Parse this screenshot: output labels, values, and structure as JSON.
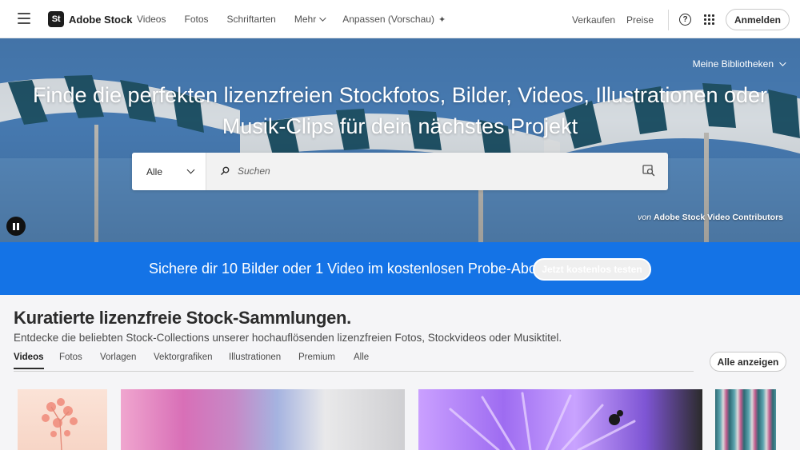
{
  "header": {
    "brand_badge": "St",
    "brand_name": "Adobe Stock",
    "nav": [
      "Videos",
      "Fotos",
      "Schriftarten",
      "Mehr",
      "Anpassen (Vorschau)"
    ],
    "sell": "Verkaufen",
    "pricing": "Preise",
    "help_glyph": "?",
    "login": "Anmelden"
  },
  "hero": {
    "libraries": "Meine Bibliotheken",
    "title_line1": "Finde die perfekten lizenzfreien Stockfotos, Bilder, Videos, Illustrationen oder",
    "title_line2": "Musik-Clips für dein nächstes Projekt",
    "search": {
      "type_value": "Alle",
      "placeholder": "Suchen"
    },
    "credit_prefix": "von",
    "credit_name": "Adobe Stock Video Contributors"
  },
  "promo": {
    "text": "Sichere dir 10 Bilder oder 1 Video im kostenlosen Probe-Abo.",
    "button": "Jetzt kostenlos testen"
  },
  "collections": {
    "title": "Kuratierte lizenzfreie Stock-Sammlungen.",
    "subtitle": "Entdecke die beliebten Stock-Collections unserer hochauflösenden lizenzfreien Fotos, Stockvideos oder Musiktitel.",
    "tabs": [
      "Videos",
      "Fotos",
      "Vorlagen",
      "Vektorgrafiken",
      "Illustrationen",
      "Premium",
      "Alle"
    ],
    "active_tab": "Videos",
    "show_all": "Alle anzeigen"
  },
  "colors": {
    "promo_blue": "#1473e6",
    "text_dark": "#2c2c2c"
  },
  "icons": [
    "menu-icon",
    "chevron-down-icon",
    "sparkle-icon",
    "help-icon",
    "apps-grid-icon",
    "search-icon",
    "visual-search-icon",
    "pause-icon"
  ]
}
